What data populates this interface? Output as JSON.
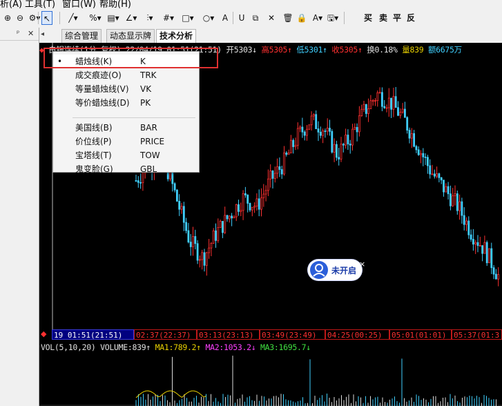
{
  "menubar": {
    "items": [
      "析(A)",
      "工具(T)",
      "窗口(W)",
      "帮助(H)"
    ]
  },
  "toolbar": {
    "buttons": [
      {
        "name": "zoom-in-icon",
        "glyph": "⊕"
      },
      {
        "name": "zoom-out-icon",
        "glyph": "⊖"
      },
      {
        "name": "settings-icon",
        "glyph": "⚙▾"
      },
      {
        "name": "pointer-icon",
        "glyph": "↖",
        "selected": true
      },
      {
        "name": "line-draw-icon",
        "glyph": "╱▾"
      },
      {
        "name": "percent-icon",
        "glyph": "%▾"
      },
      {
        "name": "ruler-icon",
        "glyph": "▤▾"
      },
      {
        "name": "angle-icon",
        "glyph": "∠▾"
      },
      {
        "name": "grid-lines-icon",
        "glyph": "⫶▾"
      },
      {
        "name": "hash-grid-icon",
        "glyph": "#▾"
      },
      {
        "name": "rectangle-icon",
        "glyph": "□▾"
      },
      {
        "name": "circle-icon",
        "glyph": "○▾"
      },
      {
        "name": "text-icon",
        "glyph": "A"
      },
      {
        "name": "magnet-icon",
        "glyph": "U"
      },
      {
        "name": "copy-icon",
        "glyph": "⧉"
      },
      {
        "name": "delete-icon",
        "glyph": "✕"
      },
      {
        "name": "trash-icon",
        "glyph": "🗑"
      },
      {
        "name": "lock-icon",
        "glyph": "🔒"
      },
      {
        "name": "font-color-icon",
        "glyph": "A▾"
      },
      {
        "name": "save-icon",
        "glyph": "🖫▾"
      }
    ],
    "trade_buttons": [
      "买",
      "卖",
      "平",
      "反"
    ]
  },
  "tabs": [
    "综合管理",
    "动态显示牌",
    "技术分析"
  ],
  "active_tab": 2,
  "info_line": [
    {
      "text": "白银连续(1分 复权) 22/04/19 01:51(21:51)",
      "color": "#e0e0e0"
    },
    {
      "text": "开5303↓",
      "color": "#e0e0e0"
    },
    {
      "text": "高5305↑",
      "color": "#ff3030"
    },
    {
      "text": "低5301↑",
      "color": "#40d0ff"
    },
    {
      "text": "收5305↑",
      "color": "#ff3030"
    },
    {
      "text": "换0.18%",
      "color": "#e0e0e0"
    },
    {
      "text": "量839",
      "color": "#e8d000"
    },
    {
      "text": "额6675万",
      "color": "#40d0ff"
    }
  ],
  "context_menu": {
    "group1": [
      {
        "label": "蜡烛线(K)",
        "key": "K",
        "checked": true
      },
      {
        "label": "成交痕迹(O)",
        "key": "TRK"
      },
      {
        "label": "等量蜡烛线(V)",
        "key": "VK"
      },
      {
        "label": "等价蜡烛线(D)",
        "key": "PK"
      }
    ],
    "group2": [
      {
        "label": "美国线(B)",
        "key": "BAR"
      },
      {
        "label": "价位线(P)",
        "key": "PRICE"
      },
      {
        "label": "宝塔线(T)",
        "key": "TOW"
      },
      {
        "label": "鬼变脸(G)",
        "key": "GBL"
      }
    ]
  },
  "time_axis": [
    "19 01:51(21:51)",
    "02:37(22:37)",
    "03:13(23:13)",
    "03:49(23:49)",
    "04:25(00:25)",
    "05:01(01:01)",
    "05:37(01:3"
  ],
  "volume_line": [
    {
      "text": "VOL(5,10,20) VOLUME:839↑",
      "color": "#e0e0e0"
    },
    {
      "text": "MA1:789.2↑",
      "color": "#e8d000"
    },
    {
      "text": "MA2:1053.2↓",
      "color": "#ff40ff"
    },
    {
      "text": "MA3:1695.7↓",
      "color": "#40e040"
    }
  ],
  "badge": {
    "label": "未开启",
    "close": "×"
  },
  "colors": {
    "up": "#ff3030",
    "down": "#40d0ff",
    "neutral": "#e0e0e0",
    "ma1": "#e8d000",
    "ma2": "#ff40ff",
    "ma3": "#40e040"
  },
  "chart_data": {
    "type": "candlestick",
    "symbol": "白银连续(1分 复权)",
    "last": {
      "open": 5303,
      "high": 5305,
      "low": 5301,
      "close": 5305,
      "turnover": "0.18%",
      "volume": 839,
      "amount": "6675万"
    },
    "close_trend": [
      5296,
      5298,
      5299,
      5294,
      5289,
      5287,
      5290,
      5292,
      5294,
      5293,
      5296,
      5298,
      5301,
      5303,
      5302,
      5299,
      5301,
      5304,
      5306,
      5305,
      5303,
      5300,
      5297,
      5295,
      5293,
      5290,
      5288,
      5285
    ],
    "volume_ma": {
      "MA1": 789.2,
      "MA2": 1053.2,
      "MA3": 1695.7
    }
  }
}
